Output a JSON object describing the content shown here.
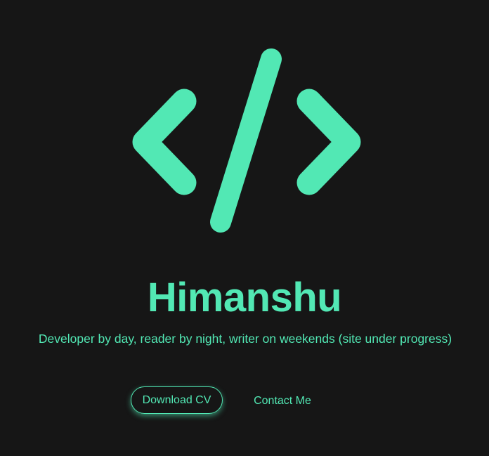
{
  "colors": {
    "background": "#161616",
    "accent": "#52e8b4"
  },
  "logo": {
    "icon": "code-brackets-icon"
  },
  "hero": {
    "name": "Himanshu",
    "tagline": "Developer by day, reader by night, writer on weekends (site under progress)"
  },
  "actions": {
    "download_cv": "Download CV",
    "contact_me": "Contact Me"
  }
}
